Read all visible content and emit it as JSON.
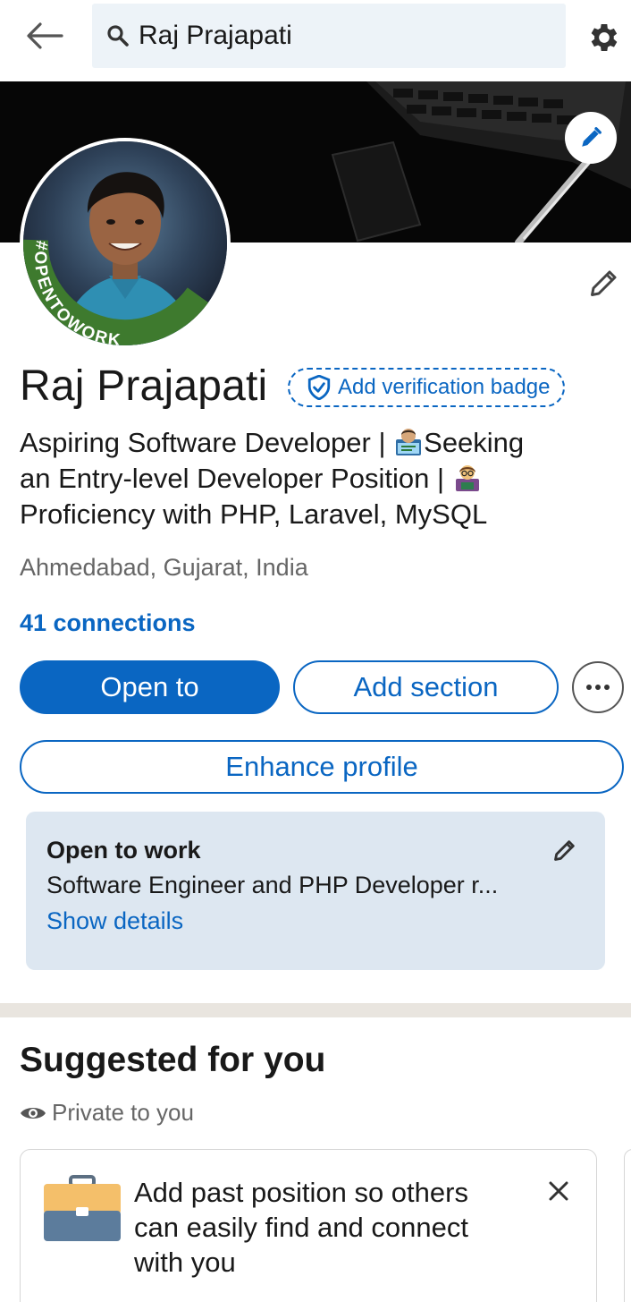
{
  "search": {
    "value": "Raj Prajapati"
  },
  "profile": {
    "name": "Raj Prajapati",
    "verification_badge_label": "Add verification badge",
    "headline_parts": [
      "Aspiring Software Developer | ",
      "Seeking",
      "an Entry-level Developer Position | ",
      "Proficiency with PHP, Laravel, MySQL"
    ],
    "location": "Ahmedabad, Gujarat, India",
    "connections": "41 connections",
    "frame_text": "#OPENTOWORK"
  },
  "actions": {
    "open_to": "Open to",
    "add_section": "Add section",
    "enhance_profile": "Enhance profile"
  },
  "open_to_work": {
    "title": "Open to work",
    "description": "Software Engineer and PHP Developer r...",
    "link": "Show details"
  },
  "suggested": {
    "title": "Suggested for you",
    "privacy": "Private to you",
    "card_text": "Add past position so others can easily find and connect with you"
  },
  "colors": {
    "accent": "#0a66c2",
    "open_to_work_green": "#3e7a2e",
    "card_bg": "#dde7f1"
  }
}
